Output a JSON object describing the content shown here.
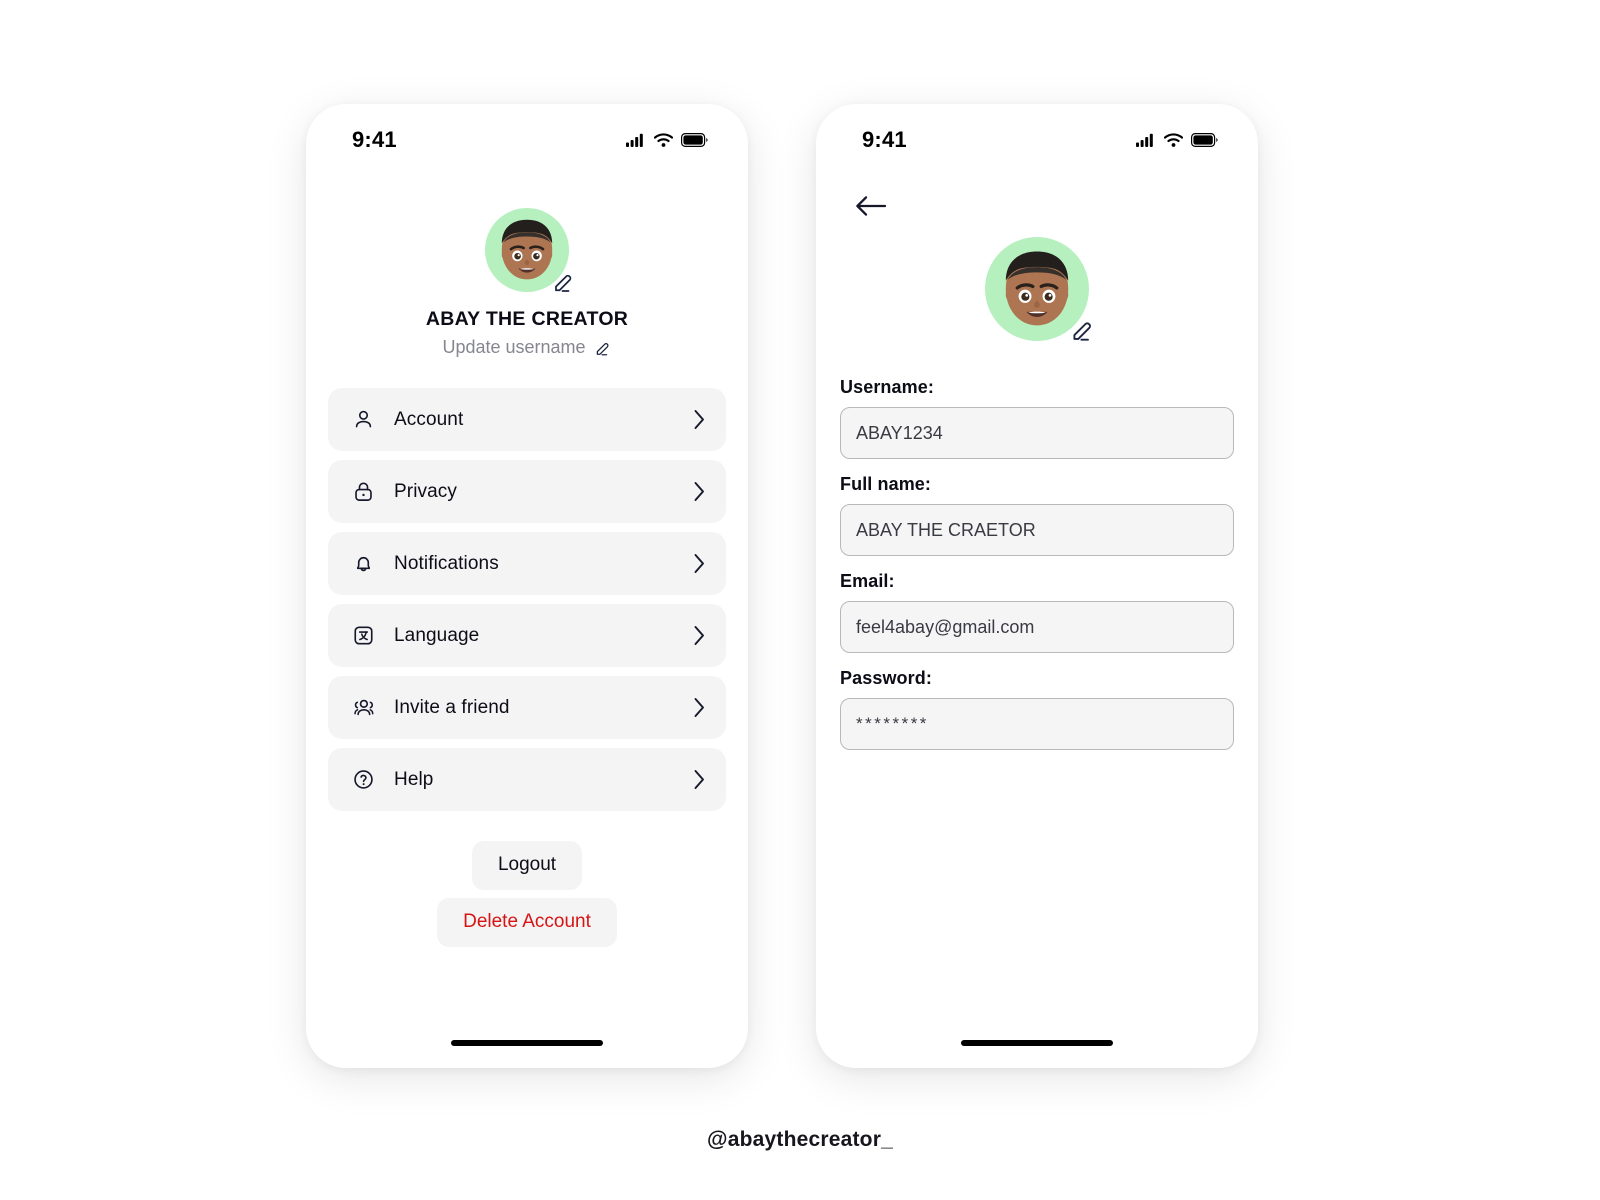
{
  "page": {
    "background": "#ffffff",
    "footer_handle": "@abaythecreator_"
  },
  "colors": {
    "accent_green": "#b6f0bf",
    "row_bg": "#f4f4f5",
    "danger": "#d71414",
    "ink": "#0d0d17",
    "muted": "#868691"
  },
  "screen1": {
    "statusbar": {
      "time": "9:41",
      "icons": [
        "cellular-signal-icon",
        "wifi-icon",
        "battery-icon"
      ]
    },
    "avatar": {
      "name": "avatar",
      "edit_icon": "pencil-icon"
    },
    "profile": {
      "name": "ABAY THE CREATOR",
      "update_label": "Update username",
      "update_icon": "pencil-icon"
    },
    "menu": [
      {
        "label": "Account",
        "icon": "user-icon",
        "chevron": "chevron-right-icon"
      },
      {
        "label": "Privacy",
        "icon": "lock-icon",
        "chevron": "chevron-right-icon"
      },
      {
        "label": "Notifications",
        "icon": "bell-icon",
        "chevron": "chevron-right-icon"
      },
      {
        "label": "Language",
        "icon": "translate-icon",
        "chevron": "chevron-right-icon"
      },
      {
        "label": "Invite a friend",
        "icon": "users-group-icon",
        "chevron": "chevron-right-icon"
      },
      {
        "label": "Help",
        "icon": "question-mark-icon",
        "chevron": "chevron-right-icon"
      }
    ],
    "actions": {
      "logout": "Logout",
      "delete": "Delete Account"
    }
  },
  "screen2": {
    "statusbar": {
      "time": "9:41",
      "icons": [
        "cellular-signal-icon",
        "wifi-icon",
        "battery-icon"
      ]
    },
    "back_icon": "arrow-left-icon",
    "avatar": {
      "name": "avatar",
      "edit_icon": "pencil-icon"
    },
    "fields": [
      {
        "label": "Username:",
        "value": "ABAY1234"
      },
      {
        "label": "Full name:",
        "value": "ABAY THE CRAETOR"
      },
      {
        "label": "Email:",
        "value": "feel4abay@gmail.com"
      },
      {
        "label": "Password:",
        "value": "********"
      }
    ]
  }
}
